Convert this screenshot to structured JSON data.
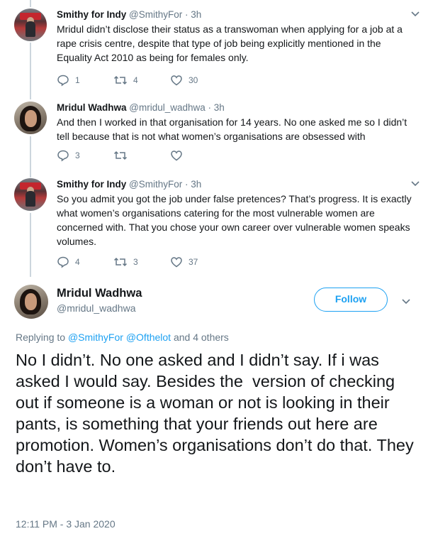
{
  "tweets": [
    {
      "name": "Smithy for Indy",
      "handle": "@SmithyFor",
      "time": "3h",
      "text": "Mridul didn’t disclose their status as a transwoman when applying for a job at a rape crisis centre, despite that type of job being explicitly mentioned in the Equality Act 2010 as being for females only.",
      "replies": "1",
      "retweets": "4",
      "likes": "30"
    },
    {
      "name": "Mridul Wadhwa",
      "handle": "@mridul_wadhwa",
      "time": "3h",
      "text": "And then I worked in that organisation for 14 years. No one asked me so I didn’t tell because that is not what women’s organisations are obsessed with",
      "replies": "3",
      "retweets": "",
      "likes": ""
    },
    {
      "name": "Smithy for Indy",
      "handle": "@SmithyFor",
      "time": "3h",
      "text": "So you admit you got the job under false pretences? That’s progress. It is exactly what women’s organisations catering for the most vulnerable women are concerned with. That you chose your own career over vulnerable women speaks volumes.",
      "replies": "4",
      "retweets": "3",
      "likes": "37"
    }
  ],
  "main_tweet": {
    "name": "Mridul Wadhwa",
    "handle": "@mridul_wadhwa",
    "follow_label": "Follow",
    "replying_prefix": "Replying to",
    "replying_user1": "@SmithyFor",
    "replying_user2": "@Ofthelot",
    "replying_suffix": "and 4 others",
    "text": "No I didn’t. No one asked and I didn’t say. If i was asked I would say. Besides the  version of checking out if someone is a woman or not is looking in their pants, is something that your friends out here are promotion. Women’s organisations don’t do that. They don’t have to.",
    "timestamp": "12:11 PM - 3 Jan 2020"
  },
  "colors": {
    "accent": "#1da1f2",
    "muted": "#657786",
    "thread_line": "#ccd6dd"
  },
  "icons": [
    "reply-icon",
    "retweet-icon",
    "like-icon",
    "chevron-down-icon"
  ]
}
